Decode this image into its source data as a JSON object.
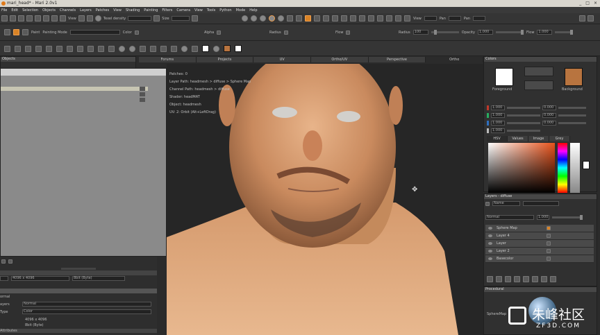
{
  "window": {
    "title": "mari_head* - Mari 2.0v1",
    "controls": [
      "_",
      "□",
      "×"
    ]
  },
  "menu": [
    "File",
    "Edit",
    "Selection",
    "Objects",
    "Channels",
    "Layers",
    "Patches",
    "View",
    "Shading",
    "Painting",
    "Filters",
    "Camera",
    "View",
    "Tools",
    "Python",
    "Mode",
    "Help"
  ],
  "toolbar1": {
    "view_label": "View",
    "texel_density_label": "Texel density",
    "size_label": "Size",
    "view2_label": "View",
    "pan_label": "Pan",
    "pan2_label": "Pan"
  },
  "toolbar2": {
    "paint_label": "Paint",
    "painting_mode_label": "Painting Mode",
    "color_label": "Color",
    "alpha_label": "Alpha",
    "radius_label": "Radius",
    "flow_label": "Flow",
    "radius2_label": "Radius",
    "radius_value": "100",
    "opacity_label": "Opacity",
    "opacity_value": "1.000",
    "flow2_label": "Flow",
    "flow_value": "1.000"
  },
  "objects_panel": {
    "title": "Objects"
  },
  "left_bottom": {
    "size_value": "4096 x 4096",
    "depth_value": "8bit (Byte)",
    "normal_label": "ormal",
    "layers_label": "ayers",
    "layers_value": "Normal",
    "type_label": "Type",
    "type_value": "Color",
    "res_value": "4096 x 4096",
    "bit_value": "8bit (Byte)",
    "attributes_label": "Attributes"
  },
  "viewport": {
    "tabs": [
      "Forums",
      "Projects",
      "UV",
      "Ortho/UV",
      "Perspective",
      "Ortho"
    ],
    "active_tab": "Ortho",
    "info": [
      "Patches: 0",
      "Layer Path: headmesh > diffuse > Sphere Map",
      "Channel Path: headmesh > diffuse",
      "Shader: headMAT",
      "Object: headmesh",
      "UV: 2: Orbit (Alt+LeftDrag)"
    ]
  },
  "colors_panel": {
    "title": "Colors",
    "foreground_label": "Foreground",
    "background_label": "Background",
    "foreground_color": "#ffffff",
    "background_color": "#b8743f",
    "rgb_values": [
      "1.000",
      "1.000",
      "1.000",
      "1.000"
    ],
    "rgb_values2": [
      "0.000",
      "0.000",
      "0.000"
    ],
    "tabs": [
      "HSV",
      "Values",
      "Image",
      "Grey"
    ]
  },
  "layers_panel": {
    "title": "Layers - diffuse",
    "filter_value": "Name",
    "blend_value": "Normal",
    "opacity_value": "1.000",
    "layers": [
      "Sphere Map",
      "Layer 4",
      "Layer",
      "Layer 2",
      "Basecolor"
    ]
  },
  "procedural_panel": {
    "title": "Procedural",
    "item_label": "SphereMap"
  },
  "watermark": {
    "brand": "朱峰社区",
    "site": "ZF3D.COM"
  },
  "accent_color": "#d98326"
}
